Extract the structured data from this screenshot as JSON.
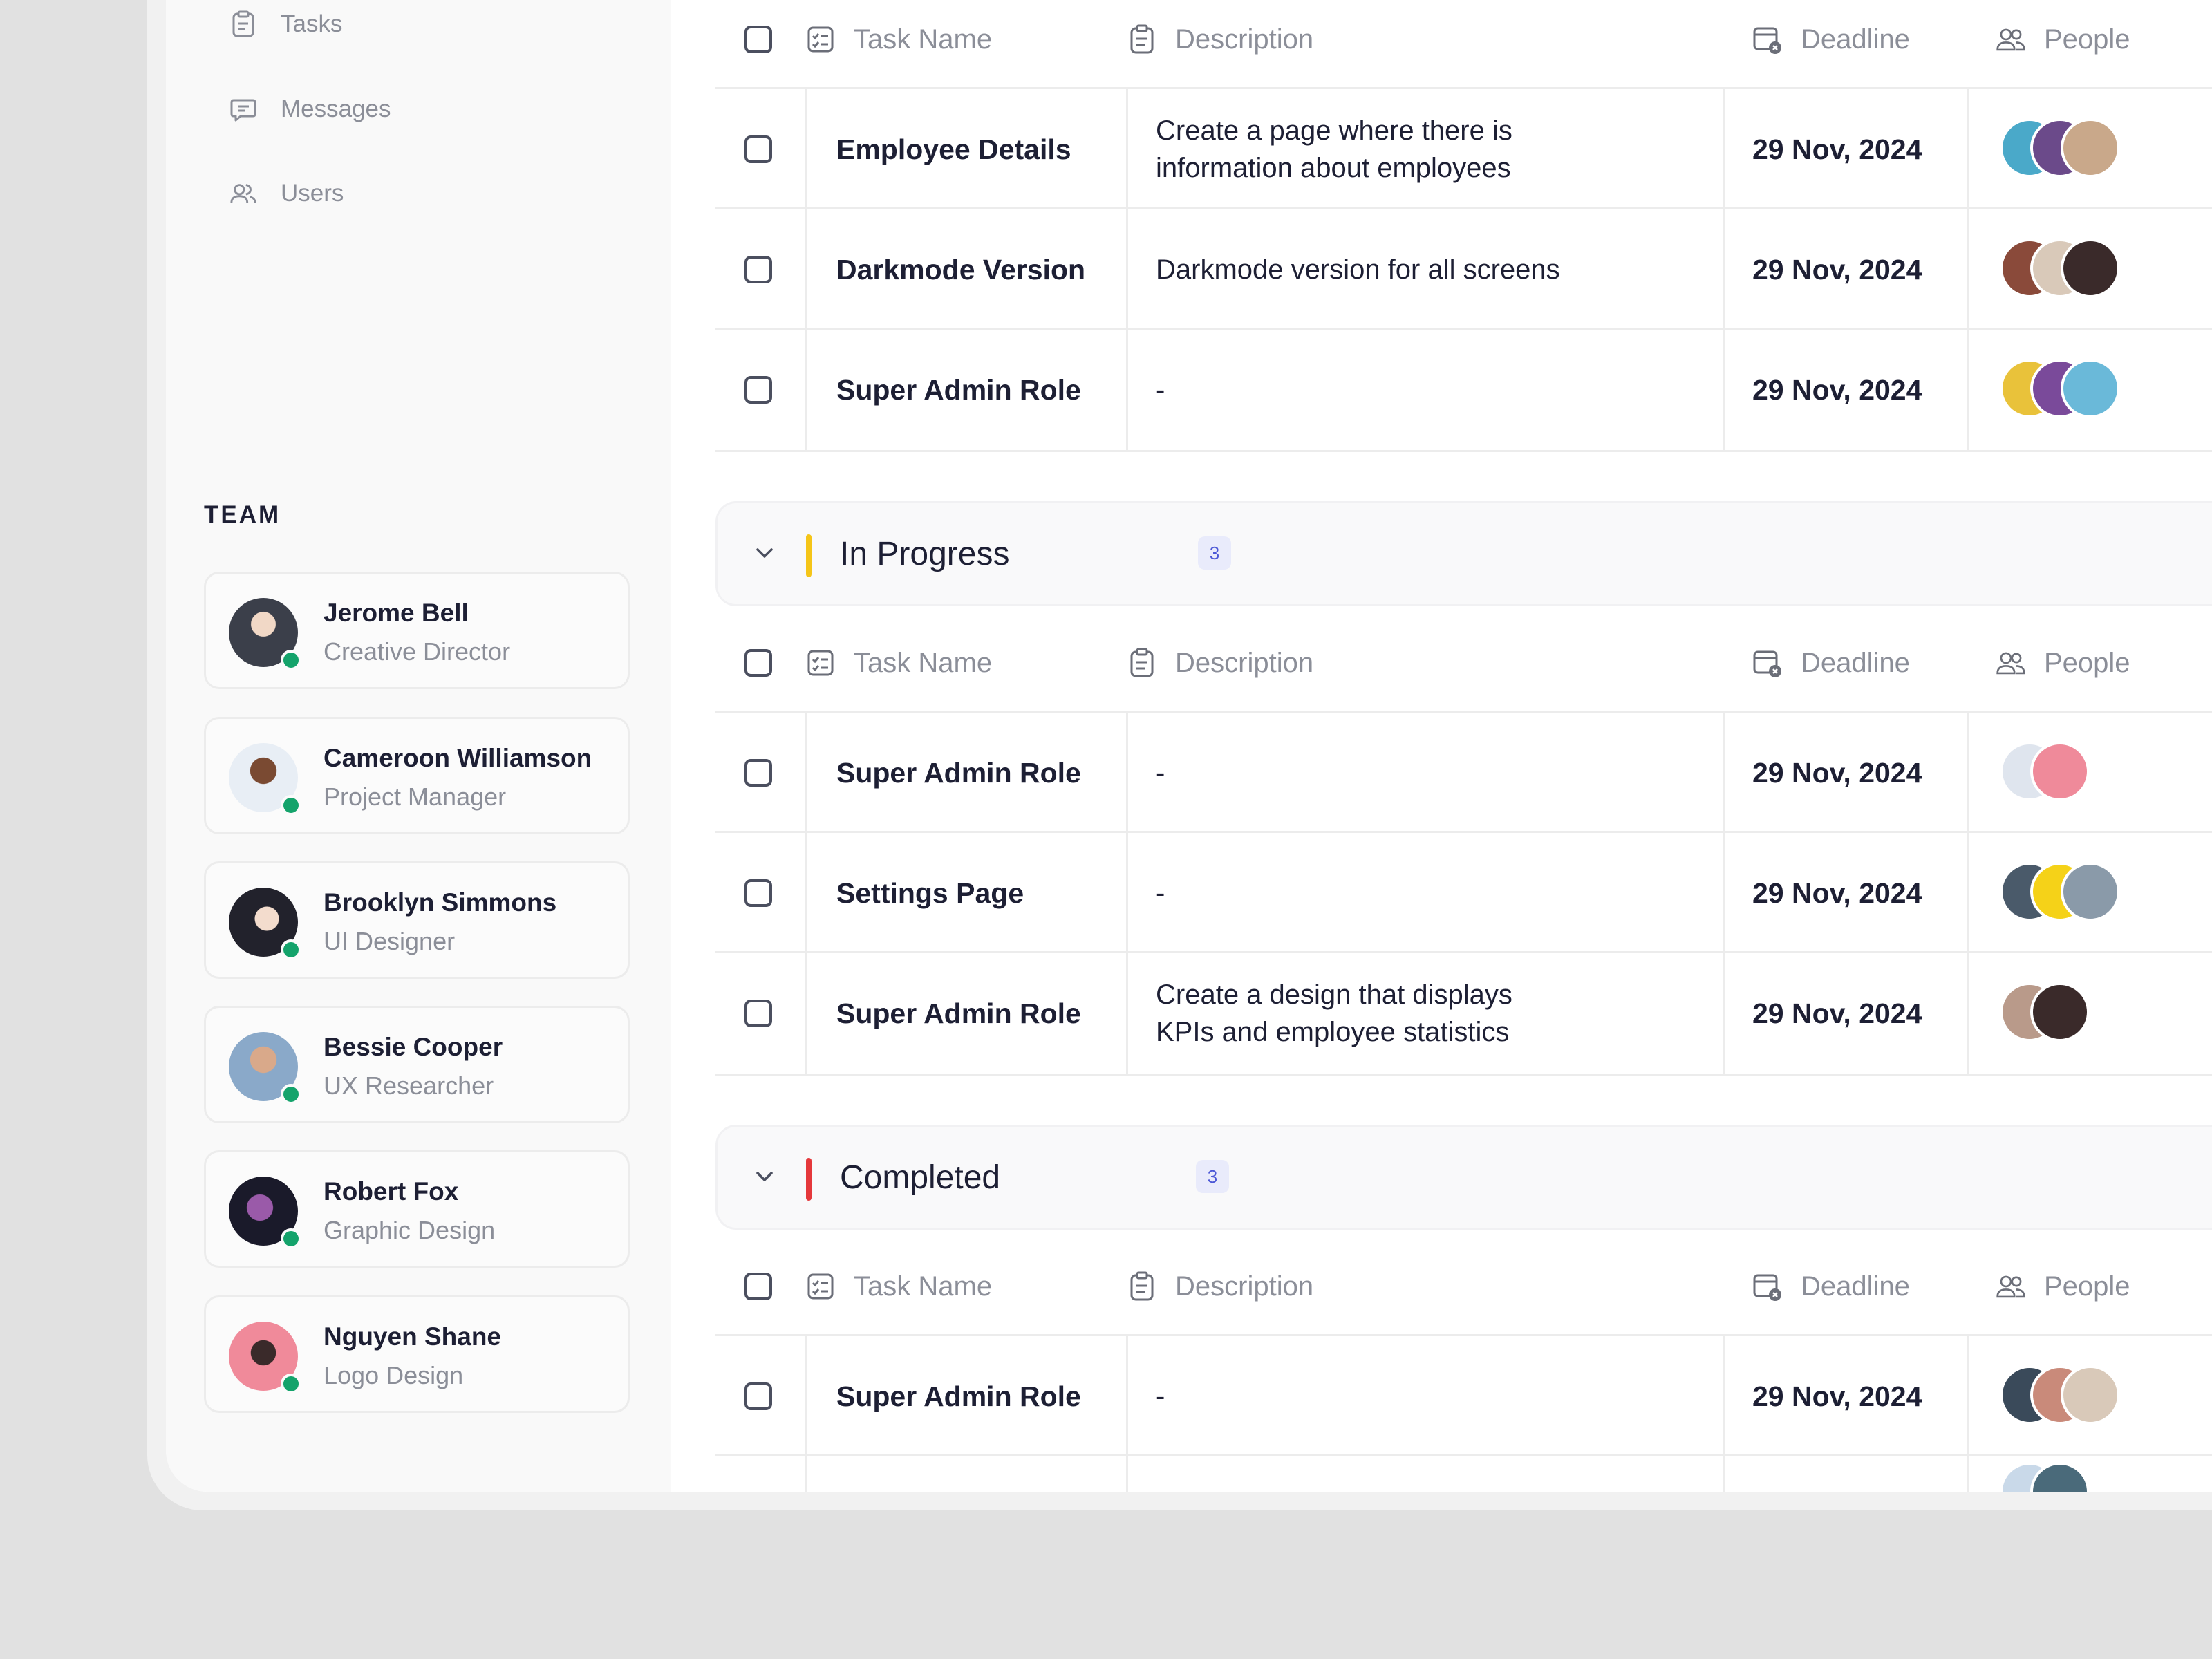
{
  "nav": {
    "items": [
      {
        "label": "Tasks",
        "icon": "clipboard-icon"
      },
      {
        "label": "Messages",
        "icon": "message-icon"
      },
      {
        "label": "Users",
        "icon": "users-icon"
      }
    ]
  },
  "team": {
    "heading": "TEAM",
    "members": [
      {
        "name": "Jerome Bell",
        "role": "Creative Director",
        "avatar_color": "#3b3f4a",
        "online": true
      },
      {
        "name": "Cameroon Williamson",
        "role": "Project Manager",
        "avatar_color": "#5a3a2a",
        "online": true
      },
      {
        "name": "Brooklyn Simmons",
        "role": "UI Designer",
        "avatar_color": "#2a2a36",
        "online": true
      },
      {
        "name": "Bessie Cooper",
        "role": "UX Researcher",
        "avatar_color": "#7a6a5a",
        "online": true
      },
      {
        "name": "Robert Fox",
        "role": "Graphic Design",
        "avatar_color": "#5b3a6a",
        "online": true
      },
      {
        "name": "Nguyen Shane",
        "role": "Logo Design",
        "avatar_color": "#e27a8a",
        "online": true
      }
    ]
  },
  "columns": {
    "task_name": "Task Name",
    "description": "Description",
    "deadline": "Deadline",
    "people": "People"
  },
  "groups": [
    {
      "title": "",
      "count": "",
      "rows": [
        {
          "name": "Employee Details",
          "description": "Create a page where there is\ninformation about  employees",
          "deadline": "29 Nov, 2024",
          "people": [
            "#4aa9c9",
            "#6b4a8a",
            "#c9a88a"
          ]
        },
        {
          "name": "Darkmode Version",
          "description": "Darkmode version for all screens",
          "deadline": "29 Nov, 2024",
          "people": [
            "#8a4a3a",
            "#d9c9b9",
            "#3a2a2a"
          ]
        },
        {
          "name": "Super Admin Role",
          "description": "-",
          "deadline": "29 Nov, 2024",
          "people": [
            "#e9c23a",
            "#7a4a9a",
            "#6ab9d9"
          ]
        }
      ]
    },
    {
      "title": "In Progress",
      "count": "3",
      "accent": "#f5c518",
      "rows": [
        {
          "name": "Super Admin Role",
          "description": "-",
          "deadline": "29 Nov, 2024",
          "people": [
            "#dfe5ee",
            "#ef8a9a"
          ]
        },
        {
          "name": "Settings Page",
          "description": "-",
          "deadline": "29 Nov, 2024",
          "people": [
            "#4a5a6a",
            "#f5d218",
            "#8a9aa9"
          ]
        },
        {
          "name": "Super Admin Role",
          "description": "Create a design that displays\nKPIs and employee statistics",
          "deadline": "29 Nov, 2024",
          "people": [
            "#b99a8a",
            "#3a2a2a"
          ]
        }
      ]
    },
    {
      "title": "Completed",
      "count": "3",
      "accent": "#e5383b",
      "rows": [
        {
          "name": "Super Admin Role",
          "description": "-",
          "deadline": "29 Nov, 2024",
          "people": [
            "#3a4a5a",
            "#c98a7a",
            "#d9c9b9"
          ]
        }
      ]
    }
  ]
}
